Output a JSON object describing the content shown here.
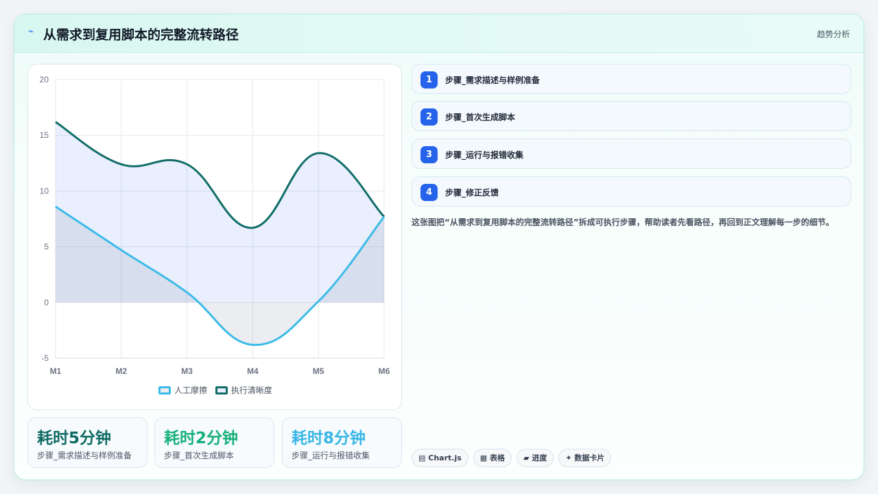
{
  "header": {
    "icon": "lightning-icon",
    "title": "从需求到复用脚本的完整流转路径",
    "tag": "趋势分析"
  },
  "chart_data": {
    "type": "area",
    "x": [
      "M1",
      "M2",
      "M3",
      "M4",
      "M5",
      "M6"
    ],
    "ylim": [
      -5,
      20
    ],
    "yticks": [
      -5,
      0,
      5,
      10,
      15,
      20
    ],
    "grid": true,
    "legend_position": "bottom",
    "series": [
      {
        "name": "人工摩擦",
        "color": "#3dbbe8",
        "fill": "rgba(100,116,139,0.13)",
        "values": [
          8.6,
          4.7,
          0.9,
          -3.8,
          0.1,
          7.7
        ]
      },
      {
        "name": "执行清晰度",
        "color": "#116e68",
        "fill": "rgba(99,140,241,0.14)",
        "values": [
          16.2,
          12.4,
          12.4,
          6.7,
          13.4,
          7.7
        ]
      }
    ]
  },
  "stats": [
    {
      "value": "耗时5分钟",
      "label": "步骤_需求描述与样例准备",
      "color": "#0f6b63"
    },
    {
      "value": "耗时2分钟",
      "label": "步骤_首次生成脚本",
      "color": "#16b07a"
    },
    {
      "value": "耗时8分钟",
      "label": "步骤_运行与报错收集",
      "color": "#39b6e6"
    }
  ],
  "steps": [
    {
      "num": "1",
      "label": "步骤_需求描述与样例准备"
    },
    {
      "num": "2",
      "label": "步骤_首次生成脚本"
    },
    {
      "num": "3",
      "label": "步骤_运行与报错收集"
    },
    {
      "num": "4",
      "label": "步骤_修正反馈"
    }
  ],
  "description": "这张图把“从需求到复用脚本的完整流转路径”拆成可执行步骤，帮助读者先看路径，再回到正文理解每一步的细节。",
  "chips": [
    {
      "icon": "chart-icon",
      "glyph": "▤",
      "label": "Chart.js"
    },
    {
      "icon": "table-icon",
      "glyph": "▦",
      "label": "表格"
    },
    {
      "icon": "progress-icon",
      "glyph": "▰",
      "label": "进度"
    },
    {
      "icon": "sparkle-icon",
      "glyph": "✦",
      "label": "数据卡片"
    }
  ]
}
